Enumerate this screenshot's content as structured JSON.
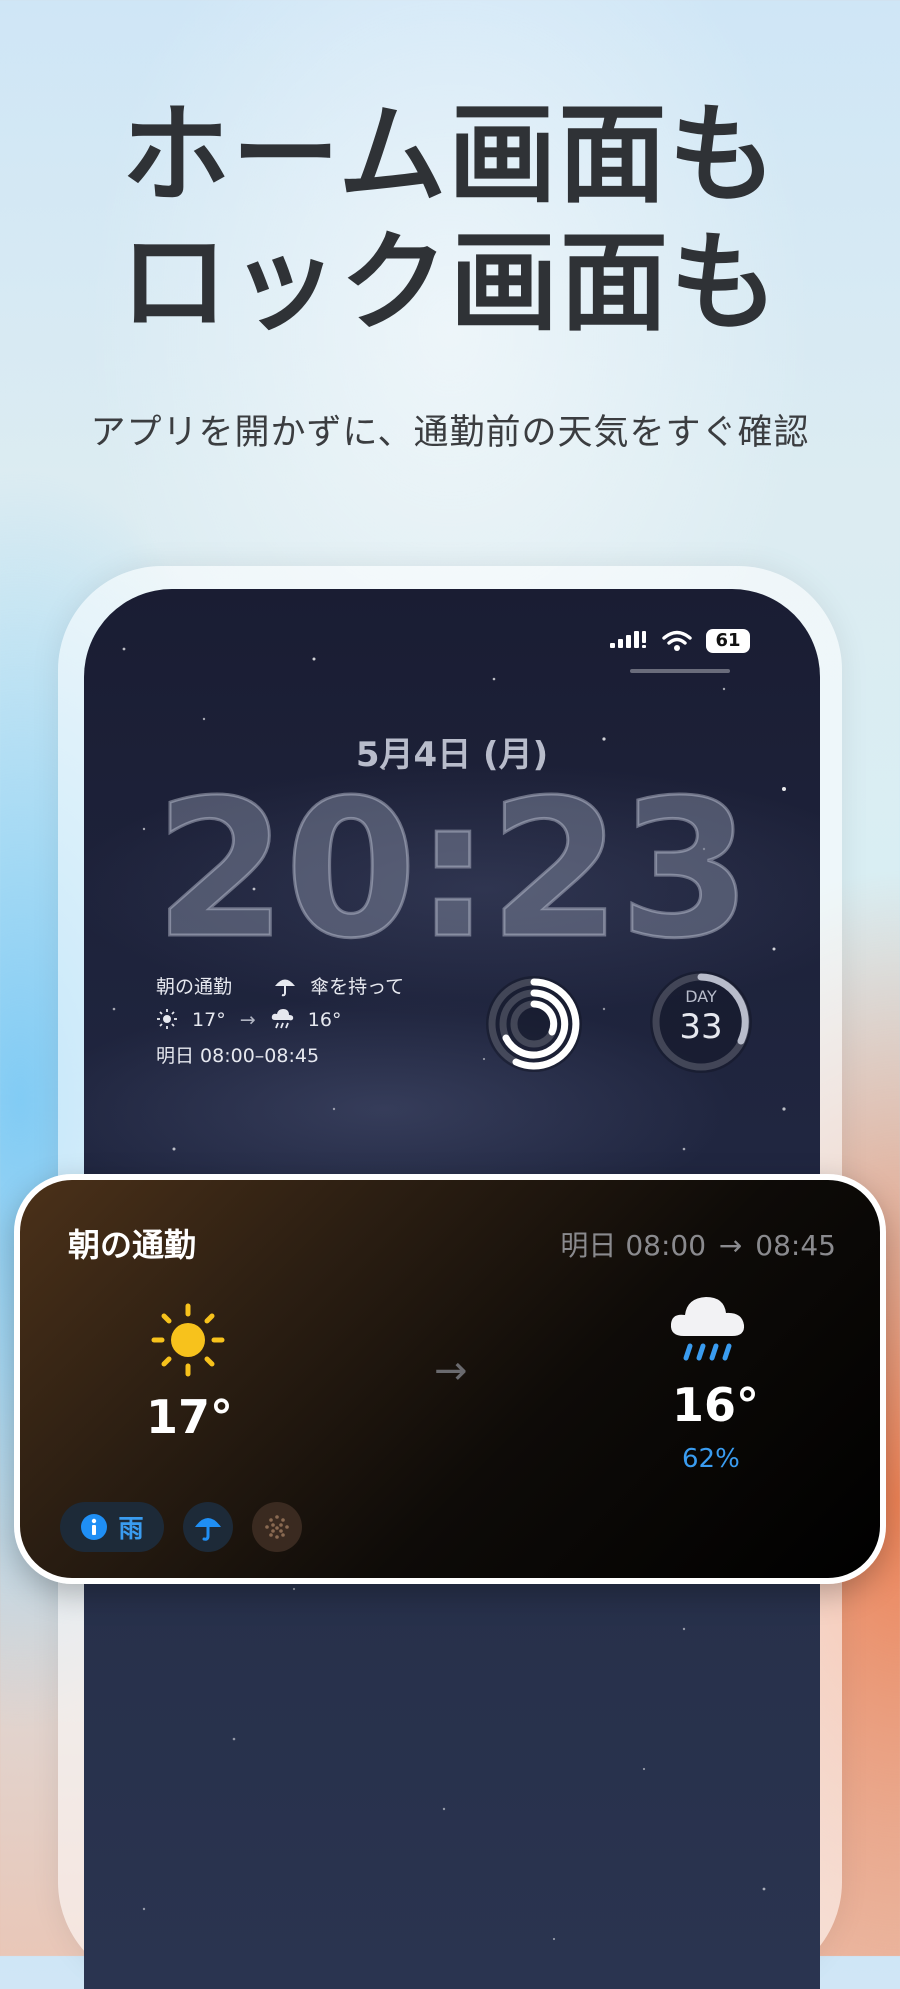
{
  "headline": {
    "line1": "ホーム画面も",
    "line2": "ロック画面も"
  },
  "subhead": "アプリを開かずに、通勤前の天気をすぐ確認",
  "status_bar": {
    "battery": "61",
    "icons": [
      "cellular-signal-icon",
      "wifi-icon",
      "battery-icon"
    ]
  },
  "lock_screen": {
    "date": "5月4日 (月)",
    "time": "20:23",
    "widget": {
      "title": "朝の通勤",
      "advice": "傘を持って",
      "from_temp": "17°",
      "to_temp": "16°",
      "window": "明日 08:00–08:45"
    },
    "day_widget": {
      "label": "DAY",
      "value": "33"
    }
  },
  "card": {
    "title": "朝の通勤",
    "time_label": "明日 08:00",
    "time_end": "08:45",
    "from": {
      "temp": "17°",
      "icon": "sun-icon"
    },
    "to": {
      "temp": "16°",
      "precip": "62%",
      "icon": "rain-cloud-icon"
    },
    "badge_label": "雨",
    "colors": {
      "accent": "#3a9cf0",
      "sun": "#f7c21c"
    }
  }
}
